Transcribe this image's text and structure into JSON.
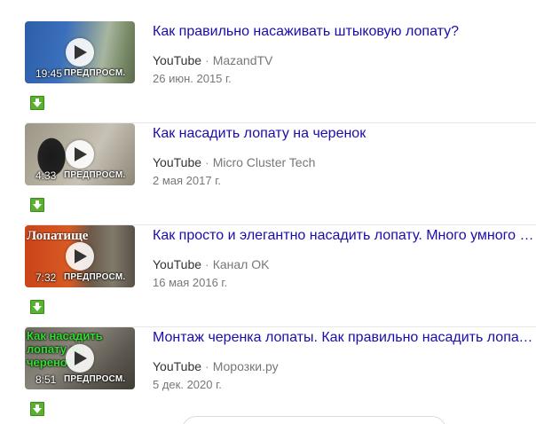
{
  "results": [
    {
      "title": "Как правильно насаживать штыковую лопату?",
      "source": "YouTube",
      "channel": "MazandTV",
      "date": "26 июн. 2015 г.",
      "duration": "19:45",
      "preview_label": "ПРЕДПРОСМ."
    },
    {
      "title": "Как насадить лопату на черенок",
      "source": "YouTube",
      "channel": "Micro Cluster Tech",
      "date": "2 мая 2017 г.",
      "duration": "4:33",
      "preview_label": "ПРЕДПРОСМ."
    },
    {
      "title": "Как просто и элегантно насадить лопату. Много умного о ...",
      "source": "YouTube",
      "channel": "Канал OK",
      "date": "16 мая 2016 г.",
      "duration": "7:32",
      "preview_label": "ПРЕДПРОСМ."
    },
    {
      "title": "Монтаж черенка лопаты. Как правильно насадить лопату ...",
      "source": "YouTube",
      "channel": "Морозки.ру",
      "date": "5 дек. 2020 г.",
      "duration": "8:51",
      "preview_label": "ПРЕДПРОСМ."
    }
  ],
  "thumbnail_text": {
    "result3": "Лопатище",
    "result4": "Как насадить лопату на черенок?"
  },
  "icons": {
    "play": "play-icon",
    "download": "download-arrow-icon"
  },
  "colors": {
    "title_link": "#1a0dab",
    "download_green": "#5ab031",
    "muted_text": "#777777"
  }
}
